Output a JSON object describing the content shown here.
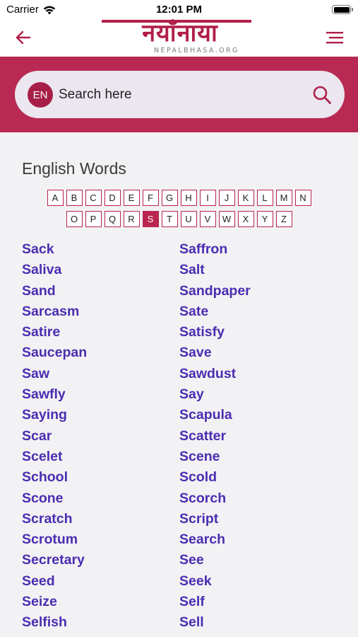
{
  "status_bar": {
    "carrier": "Carrier",
    "time": "12:01 PM"
  },
  "header": {
    "logo_text": "नयाँनाया",
    "logo_subtitle": "NEPALBHASA.ORG",
    "back_icon": "arrow-left-icon",
    "menu_icon": "hamburger-menu-icon"
  },
  "search": {
    "language": "EN",
    "placeholder": "Search here",
    "value": ""
  },
  "section_title": "English Words",
  "alphabet": {
    "row1": [
      "A",
      "B",
      "C",
      "D",
      "E",
      "F",
      "G",
      "H",
      "I",
      "J",
      "K",
      "L",
      "M",
      "N"
    ],
    "row2": [
      "O",
      "P",
      "Q",
      "R",
      "S",
      "T",
      "U",
      "V",
      "W",
      "X",
      "Y",
      "Z"
    ],
    "selected": "S"
  },
  "words": [
    "Sack",
    "Saffron",
    "Saliva",
    "Salt",
    "Sand",
    "Sandpaper",
    "Sarcasm",
    "Sate",
    "Satire",
    "Satisfy",
    "Saucepan",
    "Save",
    "Saw",
    "Sawdust",
    "Sawfly",
    "Say",
    "Saying",
    "Scapula",
    "Scar",
    "Scatter",
    "Scelet",
    "Scene",
    "School",
    "Scold",
    "Scone",
    "Scorch",
    "Scratch",
    "Script",
    "Scrotum",
    "Search",
    "Secretary",
    "See",
    "Seed",
    "Seek",
    "Seize",
    "Self",
    "Selfish",
    "Sell"
  ],
  "colors": {
    "brand": "#b82a53",
    "link": "#4b2db1"
  }
}
